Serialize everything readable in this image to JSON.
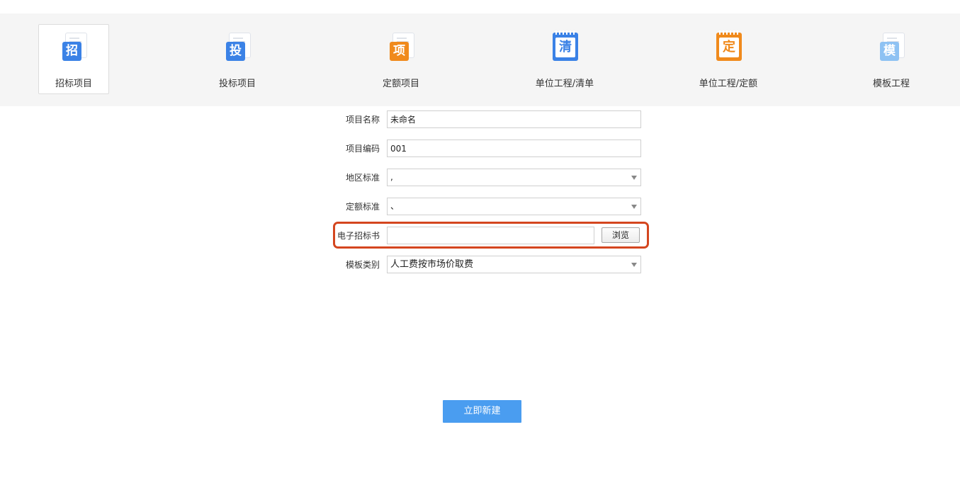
{
  "nav": {
    "items": [
      {
        "label": "招标项目",
        "icon_char": "招",
        "icon": "zhao-document-icon",
        "color": "#3b82e6"
      },
      {
        "label": "投标项目",
        "icon_char": "投",
        "icon": "tou-document-icon",
        "color": "#3b82e6"
      },
      {
        "label": "定额项目",
        "icon_char": "项",
        "icon": "xiang-document-icon",
        "color": "#f08a1c"
      },
      {
        "label": "单位工程/清单",
        "icon_char": "清",
        "icon": "qing-notebook-icon",
        "color": "#3b82e6"
      },
      {
        "label": "单位工程/定额",
        "icon_char": "定",
        "icon": "ding-notebook-icon",
        "color": "#f08a1c"
      },
      {
        "label": "模板工程",
        "icon_char": "模",
        "icon": "mo-document-icon",
        "color": "#8ec2f3"
      }
    ],
    "selected": "招标项目"
  },
  "form": {
    "project_name": {
      "label": "项目名称",
      "value": "未命名"
    },
    "project_code": {
      "label": "项目编码",
      "value": "001"
    },
    "region_standard": {
      "label": "地区标准",
      "value": ","
    },
    "quota_standard": {
      "label": "定额标准",
      "value": "、"
    },
    "bid_document": {
      "label": "电子招标书",
      "value": "",
      "browse_label": "浏览"
    },
    "template_category": {
      "label": "模板类别",
      "value": "人工费按市场价取费"
    }
  },
  "actions": {
    "create_label": "立即新建"
  },
  "colors": {
    "highlight": "#d4461f",
    "primary": "#4a9df0",
    "topbar_bg": "#f5f5f5"
  }
}
